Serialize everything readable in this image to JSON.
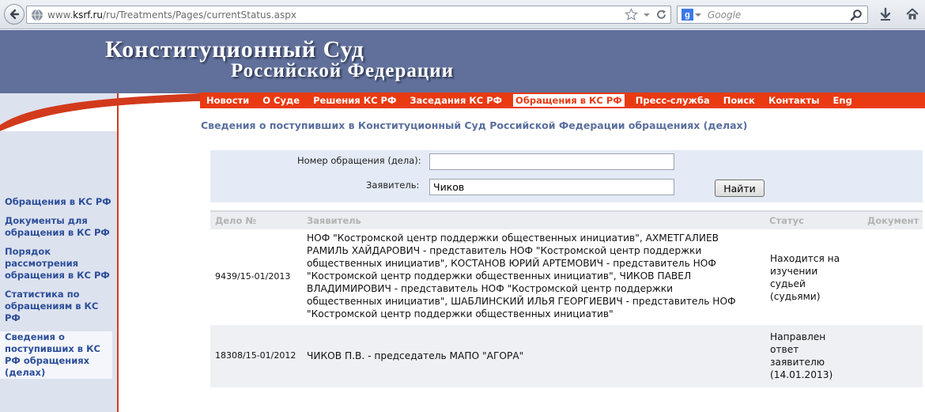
{
  "browser": {
    "url_prefix": "www.",
    "url_domain": "ksrf.ru",
    "url_path": "/ru/Treatments/Pages/currentStatus.aspx",
    "search_placeholder": "Google",
    "search_engine_letter": "g"
  },
  "site": {
    "title_line1": "Конституционный  Суд",
    "title_line2": "Российской  Федерации"
  },
  "menu": [
    {
      "label": "Новости",
      "active": false
    },
    {
      "label": "О Суде",
      "active": false
    },
    {
      "label": "Решения КС РФ",
      "active": false
    },
    {
      "label": "Заседания КС РФ",
      "active": false
    },
    {
      "label": "Обращения в КС РФ",
      "active": true
    },
    {
      "label": "Пресс-служба",
      "active": false
    },
    {
      "label": "Поиск",
      "active": false
    },
    {
      "label": "Контакты",
      "active": false
    },
    {
      "label": "Eng",
      "active": false
    }
  ],
  "sidebar": {
    "items": [
      {
        "label": "Обращения в КС РФ"
      },
      {
        "label": "Документы для обращения в КС РФ"
      },
      {
        "label": "Порядок рассмотрения обращения в КС РФ"
      },
      {
        "label": "Статистика по обращениям в КС РФ"
      },
      {
        "label": "Сведения о поступивших в КС РФ обращениях (делах)"
      }
    ]
  },
  "page": {
    "heading": "Сведения о поступивших в Конституционный Суд Российской Федерации обращениях (делах)"
  },
  "form": {
    "case_number_label": "Номер обращения (дела):",
    "case_number_value": "",
    "applicant_label": "Заявитель:",
    "applicant_value": "Чиков",
    "find_button": "Найти"
  },
  "table": {
    "headers": {
      "case": "Дело №",
      "applicant": "Заявитель",
      "status": "Статус",
      "document": "Документ"
    },
    "rows": [
      {
        "case": "9439/15-01/2013",
        "applicant_lines": [
          "НОФ \"Костромской центр поддержки общественных инициатив\", АХМЕТГАЛИЕВ",
          "РАМИЛЬ ХАЙДАРОВИЧ - представитель НОФ \"Костромской центр поддержки",
          "общественных инициатив\", КОСТАНОВ ЮРИЙ АРТЕМОВИЧ - представитель НОФ",
          "\"Костромской центр поддержки общественных инициатив\", ЧИКОВ ПАВЕЛ",
          "ВЛАДИМИРОВИЧ - представитель НОФ \"Костромской центр поддержки",
          "общественных инициатив\", ШАБЛИНСКИЙ ИЛЬЯ ГЕОРГИЕВИЧ - представитель НОФ",
          "\"Костромской центр поддержки общественных инициатив\""
        ],
        "status_lines": [
          "Находится на",
          "изучении",
          "судьей",
          "(судьями)"
        ],
        "document": ""
      },
      {
        "case": "18308/15-01/2012",
        "applicant_lines": [
          "ЧИКОВ П.В. - председатель МАПО \"АГОРА\""
        ],
        "status_lines": [
          "Направлен",
          "ответ",
          "заявителю",
          "(14.01.2013)"
        ],
        "document": ""
      }
    ]
  },
  "colors": {
    "header_bg": "#61709a",
    "menu_bg": "#e93a12",
    "link": "#2c4f99",
    "heading": "#5a6f9e",
    "form_bg": "#e4ebf6"
  }
}
